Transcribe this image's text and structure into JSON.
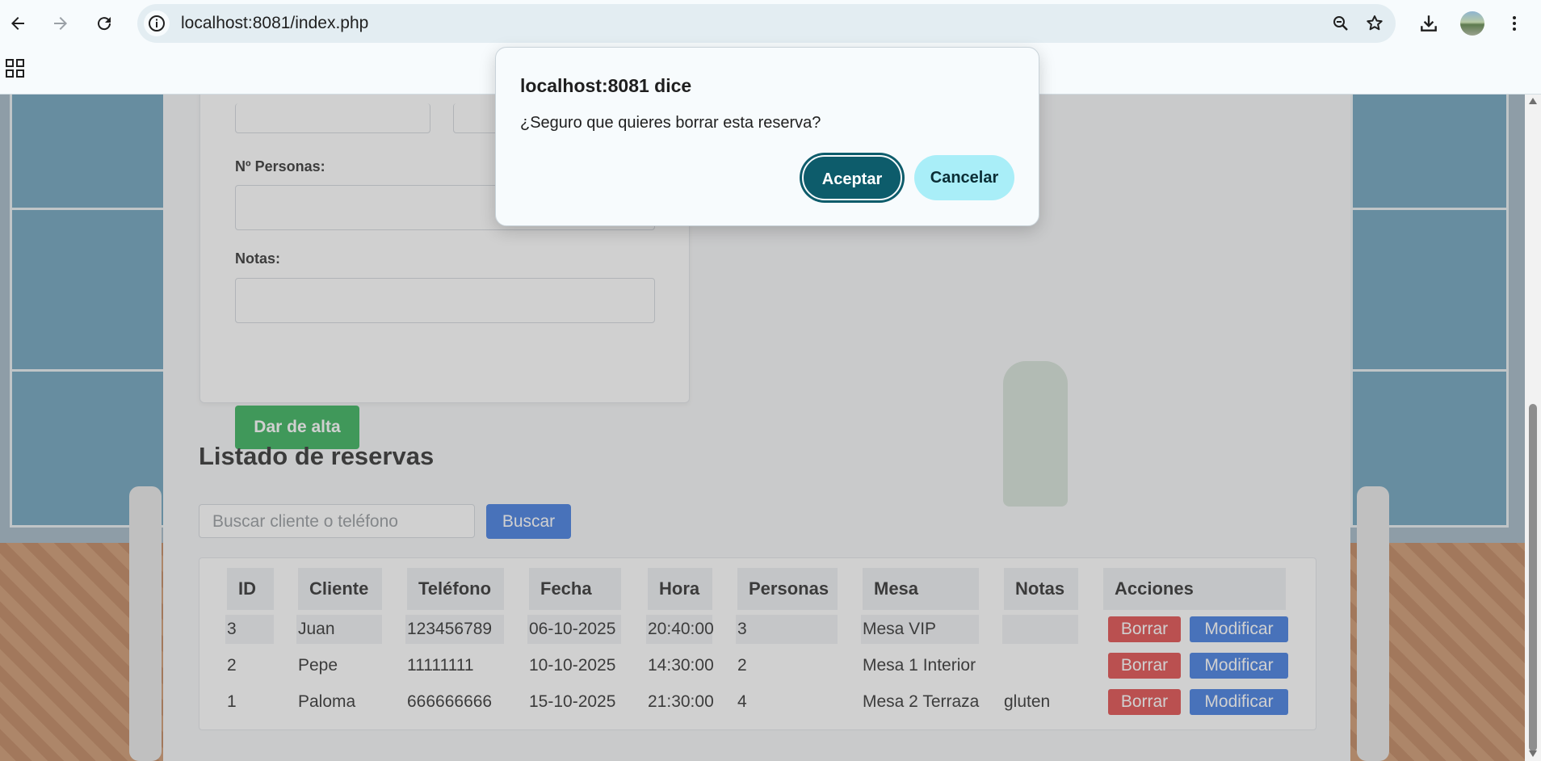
{
  "browser": {
    "url": "localhost:8081/index.php",
    "icons": [
      "back-icon",
      "forward-icon",
      "reload-icon",
      "site-info-icon",
      "zoom-icon",
      "bookmark-star-icon",
      "download-icon",
      "profile-avatar",
      "menu-icon",
      "apps-grid-icon"
    ]
  },
  "form": {
    "personas_label": "Nº Personas:",
    "notas_label": "Notas:",
    "submit_label": "Dar de alta"
  },
  "listado": {
    "title": "Listado de reservas",
    "search_placeholder": "Buscar cliente o teléfono",
    "search_button": "Buscar"
  },
  "table": {
    "headers": [
      "ID",
      "Cliente",
      "Teléfono",
      "Fecha",
      "Hora",
      "Personas",
      "Mesa",
      "Notas",
      "Acciones"
    ],
    "rows": [
      [
        "3",
        "Juan",
        "123456789",
        "06-10-2025",
        "20:40:00",
        "3",
        "Mesa VIP",
        ""
      ],
      [
        "2",
        "Pepe",
        "11111111",
        "10-10-2025",
        "14:30:00",
        "2",
        "Mesa 1 Interior",
        ""
      ],
      [
        "1",
        "Paloma",
        "666666666",
        "15-10-2025",
        "21:30:00",
        "4",
        "Mesa 2 Terraza",
        "gluten"
      ]
    ],
    "action_delete": "Borrar",
    "action_edit": "Modificar"
  },
  "dialog": {
    "title": "localhost:8081 dice",
    "message": "¿Seguro que quieres borrar esta reserva?",
    "accept": "Aceptar",
    "cancel": "Cancelar"
  },
  "colors": {
    "accept_bg": "#0d5c6b",
    "cancel_bg": "#a9eef8",
    "delete_bg": "#dd3b3b",
    "edit_bg": "#2f6fde",
    "submit_bg": "#23a94b"
  }
}
